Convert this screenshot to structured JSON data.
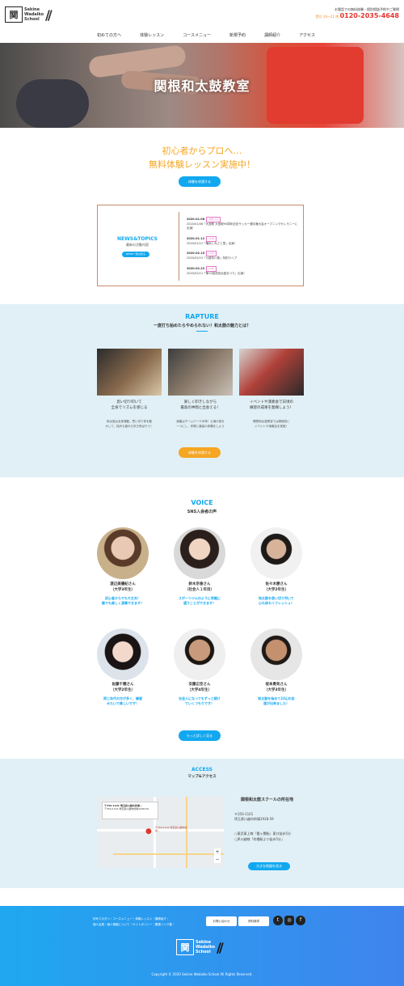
{
  "header": {
    "logo_mark": "関",
    "logo_line1": "Sekine",
    "logo_line2": "Wadaiko",
    "logo_line3": "School",
    "notice": "お電話での無料体験・個別相談予約やご質問",
    "hours": "受付 10～21 時",
    "tel": "0120-2035-4648"
  },
  "nav": [
    "初めての方へ",
    "体験レッスン",
    "コースメニュー",
    "新規予約",
    "講師紹介",
    "アクセス"
  ],
  "hero": {
    "title": "関根和太鼓教室"
  },
  "intro": {
    "line1": "初心者からプロへ…",
    "line2": "無料体験レッスン実施中！",
    "button": "体験を申請する"
  },
  "news": {
    "title": "NEWS&TOPICS",
    "subtitle": "最新の活動内容",
    "button": "NEWS一覧お見る",
    "items": [
      {
        "date": "2020.01.06",
        "tag": "お知らせ",
        "text": "2020/01/06「大宮駅 大宮駅90周年記念サッカー選手権大会オープニングセレモニーに出演！"
      },
      {
        "date": "2020.01.12",
        "tag": "LIVE",
        "text": "2020/01/12「横浜とみさと里」出演！"
      },
      {
        "date": "2020.02.15",
        "tag": "LIVE",
        "text": "2020/02/15「川越氷川祭」特別ライブ"
      },
      {
        "date": "2020.02.22",
        "tag": "LIVE",
        "text": "2020/02/11「第10回成田太鼓まつり」出演！"
      }
    ]
  },
  "rapture": {
    "title": "RAPTURE",
    "subtitle": "一度打ち始めたらやめられない！和太鼓の魅力とは？",
    "button": "体験を申請する",
    "cards": [
      {
        "heading1": "思い切り叩いて",
        "heading2": "全身でリズムを感じる",
        "text1": "和太鼓は全身運動。思い切り体を動",
        "text2": "かして、悩みも疲れも吹き飛ばそう！"
      },
      {
        "heading1": "楽しく叩きしながら",
        "heading2": "最高の仲間と出会える！",
        "text1": "演奏はチームワークが命！公演の音を",
        "text2": "一つにし、仲間と最高の体験をしよう"
      },
      {
        "heading1": "イベントや演奏会で日頃の",
        "heading2": "練習の成果を発揮しよう！",
        "text1": "関根和太鼓教室では積極的に",
        "text2": "イベントや演奏会を実施！"
      }
    ]
  },
  "voice": {
    "title": "VOICE",
    "subtitle": "SNS入会者の声",
    "button": "もっと詳しく見る",
    "people": [
      {
        "name": "渡辺美優紀さん",
        "meta": "（大学3年生）",
        "q1": "初心者からでも大丈夫！",
        "q2": "誰でも楽しく演奏できます！"
      },
      {
        "name": "鈴木京香さん",
        "meta": "（社会人１年目）",
        "q1": "スポーツジムのように気軽に",
        "q2": "通うことができます！"
      },
      {
        "name": "佐々木勝さん",
        "meta": "（大学2年生）",
        "q1": "和太鼓を思い切り叩いて",
        "q2": "心も体もリフレッシュ！"
      },
      {
        "name": "佐藤千穂さん",
        "meta": "（大学2年生）",
        "q1": "同じ年代の方が多く、練習",
        "q2": "みたいで楽しいです！"
      },
      {
        "name": "安藤正臣さん",
        "meta": "（大学4年生）",
        "q1": "社会人になってもずっと続け",
        "q2": "ていくつもりです！"
      },
      {
        "name": "坂本勇気さん",
        "meta": "（大学3年生）",
        "q1": "和太鼓を始めて23山の友",
        "q2": "達が出来ました！"
      }
    ]
  },
  "access": {
    "title": "ACCESS",
    "subtitle": "マップ&アクセス",
    "school": "関根和太鼓スクールの所在地",
    "postal": "〒350-1101",
    "address": "埼玉県川越市的場1928-59",
    "route1": "○東武東上線「霞ヶ関駅」東口徒歩5分",
    "route2": "○JR川越線「的場駅より徒歩5分」",
    "button": "大きな地図を見る",
    "map_card_title": "〒350-1101 埼玉県川越市的場...",
    "map_card_addr": "〒350-1101 埼玉県川越市的場1928-59",
    "map_pin_label": "〒350-1101 埼玉県川越市的場..."
  },
  "footer": {
    "links1": "初めての方へ｜コースメニュー｜体験レッスン｜講師紹介｜",
    "links2": "個人会員｜個人情報について｜サイトポリシー｜関連リンク集｜",
    "contact": "お問い合わせ",
    "request": "資料請求",
    "sns": [
      "t",
      "◎",
      "f"
    ],
    "copyright": "Copyright © 2020 Sekine Wadaiko School All Rights Reserved."
  }
}
